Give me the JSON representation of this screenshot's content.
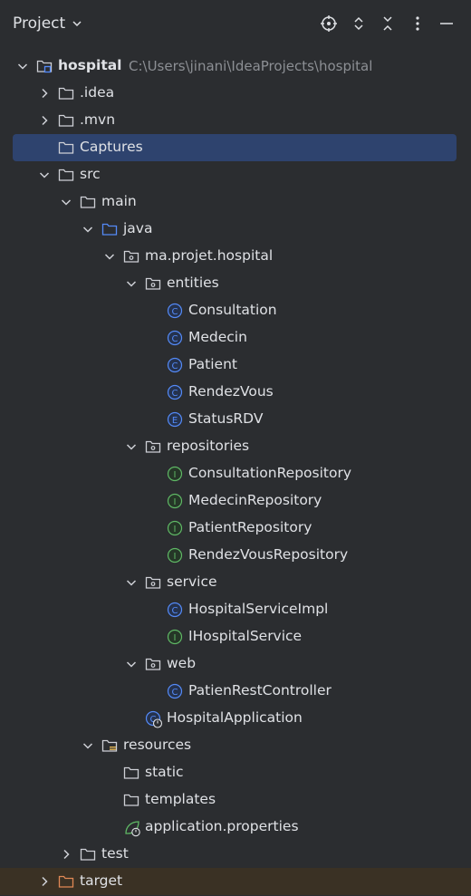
{
  "panel": {
    "title": "Project",
    "toolbar": [
      "locate-icon",
      "expand-icon",
      "collapse-icon",
      "more-icon",
      "minimize-icon"
    ]
  },
  "tree": [
    {
      "label": "hospital",
      "path": "C:\\Users\\jinani\\IdeaProjects\\hospital",
      "level": 0,
      "icon": "module-folder-icon",
      "arrow": "down",
      "bold": true
    },
    {
      "label": ".idea",
      "level": 1,
      "icon": "folder-icon",
      "arrow": "right"
    },
    {
      "label": ".mvn",
      "level": 1,
      "icon": "folder-icon",
      "arrow": "right"
    },
    {
      "label": "Captures",
      "level": 1,
      "icon": "folder-icon",
      "arrow": "none",
      "selected": true
    },
    {
      "label": "src",
      "level": 1,
      "icon": "folder-icon",
      "arrow": "down"
    },
    {
      "label": "main",
      "level": 2,
      "icon": "folder-icon",
      "arrow": "down"
    },
    {
      "label": "java",
      "level": 3,
      "icon": "source-folder-icon",
      "arrow": "down"
    },
    {
      "label": "ma.projet.hospital",
      "level": 4,
      "icon": "package-icon",
      "arrow": "down"
    },
    {
      "label": "entities",
      "level": 5,
      "icon": "package-icon",
      "arrow": "down"
    },
    {
      "label": "Consultation",
      "level": 6,
      "icon": "class-icon",
      "arrow": "none"
    },
    {
      "label": "Medecin",
      "level": 6,
      "icon": "class-icon",
      "arrow": "none"
    },
    {
      "label": "Patient",
      "level": 6,
      "icon": "class-icon",
      "arrow": "none"
    },
    {
      "label": "RendezVous",
      "level": 6,
      "icon": "class-icon",
      "arrow": "none"
    },
    {
      "label": "StatusRDV",
      "level": 6,
      "icon": "enum-icon",
      "arrow": "none"
    },
    {
      "label": "repositories",
      "level": 5,
      "icon": "package-icon",
      "arrow": "down"
    },
    {
      "label": "ConsultationRepository",
      "level": 6,
      "icon": "interface-icon",
      "arrow": "none"
    },
    {
      "label": "MedecinRepository",
      "level": 6,
      "icon": "interface-icon",
      "arrow": "none"
    },
    {
      "label": "PatientRepository",
      "level": 6,
      "icon": "interface-icon",
      "arrow": "none"
    },
    {
      "label": "RendezVousRepository",
      "level": 6,
      "icon": "interface-icon",
      "arrow": "none"
    },
    {
      "label": "service",
      "level": 5,
      "icon": "package-icon",
      "arrow": "down"
    },
    {
      "label": "HospitalServiceImpl",
      "level": 6,
      "icon": "class-icon",
      "arrow": "none"
    },
    {
      "label": "IHospitalService",
      "level": 6,
      "icon": "interface-icon",
      "arrow": "none"
    },
    {
      "label": "web",
      "level": 5,
      "icon": "package-icon",
      "arrow": "down"
    },
    {
      "label": "PatienRestController",
      "level": 6,
      "icon": "class-icon",
      "arrow": "none"
    },
    {
      "label": "HospitalApplication",
      "level": 5,
      "icon": "spring-app-icon",
      "arrow": "none"
    },
    {
      "label": "resources",
      "level": 3,
      "icon": "resources-folder-icon",
      "arrow": "down"
    },
    {
      "label": "static",
      "level": 4,
      "icon": "folder-icon",
      "arrow": "none"
    },
    {
      "label": "templates",
      "level": 4,
      "icon": "folder-icon",
      "arrow": "none"
    },
    {
      "label": "application.properties",
      "level": 4,
      "icon": "spring-properties-icon",
      "arrow": "none"
    },
    {
      "label": "test",
      "level": 2,
      "icon": "folder-icon",
      "arrow": "right"
    },
    {
      "label": "target",
      "level": 1,
      "icon": "excluded-folder-icon",
      "arrow": "right",
      "excluded": true
    }
  ],
  "colors": {
    "background": "#2b2d30",
    "selection": "#2e436e",
    "excluded_row": "#3a3124",
    "class_blue": "#548af7",
    "interface_green": "#5fb865",
    "excluded_orange": "#e08855",
    "path_gray": "#8c8f94"
  }
}
